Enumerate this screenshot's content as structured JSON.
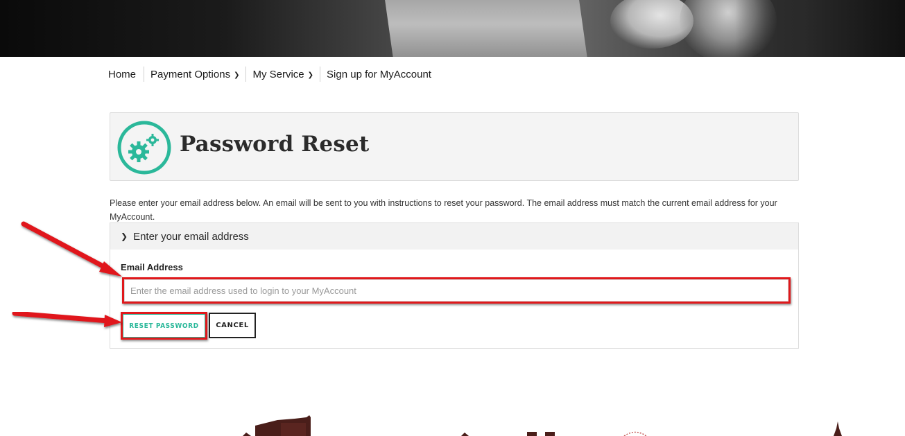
{
  "nav": {
    "items": [
      {
        "label": "Home",
        "has_dropdown": false
      },
      {
        "label": "Payment Options",
        "has_dropdown": true
      },
      {
        "label": "My Service",
        "has_dropdown": true
      },
      {
        "label": "Sign up for MyAccount",
        "has_dropdown": false
      }
    ]
  },
  "page": {
    "title": "Password Reset",
    "icon": "gears-icon",
    "description": "Please enter your email address below. An email will be sent to you with instructions to reset your password. The email address must match the current email address for your MyAccount."
  },
  "panel": {
    "header": "Enter your email address",
    "email_label": "Email Address",
    "email_value": "",
    "email_placeholder": "Enter the email address used to login to your MyAccount",
    "reset_label": "RESET PASSWORD",
    "cancel_label": "CANCEL"
  },
  "colors": {
    "accent": "#2bb89a",
    "annotation": "#e0181b",
    "skyline": "#4a1e1a"
  }
}
